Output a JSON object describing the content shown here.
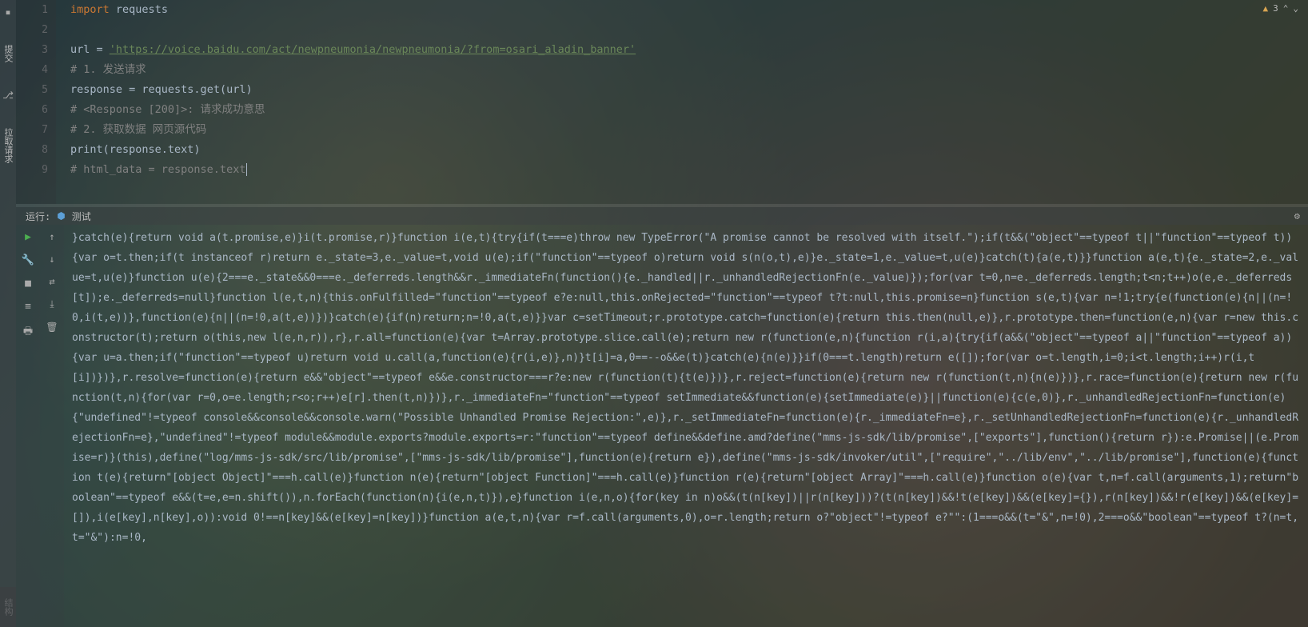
{
  "left_rail": {
    "commit_tab": "提交",
    "pull_tab": "拉取请求"
  },
  "editor": {
    "warning_count": "3",
    "lines": [
      {
        "num": "1",
        "tokens": [
          [
            "kw",
            "import"
          ],
          [
            "plain",
            " "
          ],
          [
            "ident",
            "requests"
          ]
        ]
      },
      {
        "num": "2",
        "tokens": []
      },
      {
        "num": "3",
        "tokens": [
          [
            "ident",
            "url "
          ],
          [
            "plain",
            "= "
          ],
          [
            "str",
            "'https://voice.baidu.com/act/newpneumonia/newpneumonia/?from=osari_aladin_banner'"
          ]
        ]
      },
      {
        "num": "4",
        "tokens": [
          [
            "cmt",
            "# 1. 发送请求"
          ]
        ]
      },
      {
        "num": "5",
        "tokens": [
          [
            "ident",
            "response "
          ],
          [
            "plain",
            "= requests.get(url)"
          ]
        ]
      },
      {
        "num": "6",
        "tokens": [
          [
            "cmt",
            "# <Response [200]>: 请求成功意思"
          ]
        ]
      },
      {
        "num": "7",
        "tokens": [
          [
            "cmt",
            "# 2. 获取数据 网页源代码"
          ]
        ]
      },
      {
        "num": "8",
        "tokens": [
          [
            "fn",
            "print"
          ],
          [
            "plain",
            "(response.text)"
          ]
        ]
      },
      {
        "num": "9",
        "tokens": [
          [
            "cmt",
            "# html_data = response.text"
          ]
        ],
        "cursor": true
      }
    ]
  },
  "console": {
    "run_label": "运行:",
    "run_name": "测试",
    "output": "}catch(e){return void a(t.promise,e)}i(t.promise,r)}function i(e,t){try{if(t===e)throw new TypeError(\"A promise cannot be resolved with itself.\");if(t&&(\"object\"==typeof t||\"function\"==typeof t)){var o=t.then;if(t instanceof r)return e._state=3,e._value=t,void u(e);if(\"function\"==typeof o)return void s(n(o,t),e)}e._state=1,e._value=t,u(e)}catch(t){a(e,t)}}function a(e,t){e._state=2,e._value=t,u(e)}function u(e){2===e._state&&0===e._deferreds.length&&r._immediateFn(function(){e._handled||r._unhandledRejectionFn(e._value)});for(var t=0,n=e._deferreds.length;t<n;t++)o(e,e._deferreds[t]);e._deferreds=null}function l(e,t,n){this.onFulfilled=\"function\"==typeof e?e:null,this.onRejected=\"function\"==typeof t?t:null,this.promise=n}function s(e,t){var n=!1;try{e(function(e){n||(n=!0,i(t,e))},function(e){n||(n=!0,a(t,e))})}catch(e){if(n)return;n=!0,a(t,e)}}var c=setTimeout;r.prototype.catch=function(e){return this.then(null,e)},r.prototype.then=function(e,n){var r=new this.constructor(t);return o(this,new l(e,n,r)),r},r.all=function(e){var t=Array.prototype.slice.call(e);return new r(function(e,n){function r(i,a){try{if(a&&(\"object\"==typeof a||\"function\"==typeof a)){var u=a.then;if(\"function\"==typeof u)return void u.call(a,function(e){r(i,e)},n)}t[i]=a,0==--o&&e(t)}catch(e){n(e)}}if(0===t.length)return e([]);for(var o=t.length,i=0;i<t.length;i++)r(i,t[i])})},r.resolve=function(e){return e&&\"object\"==typeof e&&e.constructor===r?e:new r(function(t){t(e)})},r.reject=function(e){return new r(function(t,n){n(e)})},r.race=function(e){return new r(function(t,n){for(var r=0,o=e.length;r<o;r++)e[r].then(t,n)})},r._immediateFn=\"function\"==typeof setImmediate&&function(e){setImmediate(e)}||function(e){c(e,0)},r._unhandledRejectionFn=function(e){\"undefined\"!=typeof console&&console&&console.warn(\"Possible Unhandled Promise Rejection:\",e)},r._setImmediateFn=function(e){r._immediateFn=e},r._setUnhandledRejectionFn=function(e){r._unhandledRejectionFn=e},\"undefined\"!=typeof module&&module.exports?module.exports=r:\"function\"==typeof define&&define.amd?define(\"mms-js-sdk/lib/promise\",[\"exports\"],function(){return r}):e.Promise||(e.Promise=r)}(this),define(\"log/mms-js-sdk/src/lib/promise\",[\"mms-js-sdk/lib/promise\"],function(e){return e}),define(\"mms-js-sdk/invoker/util\",[\"require\",\"../lib/env\",\"../lib/promise\"],function(e){function t(e){return\"[object Object]\"===h.call(e)}function n(e){return\"[object Function]\"===h.call(e)}function r(e){return\"[object Array]\"===h.call(e)}function o(e){var t,n=f.call(arguments,1);return\"boolean\"==typeof e&&(t=e,e=n.shift()),n.forEach(function(n){i(e,n,t)}),e}function i(e,n,o){for(key in n)o&&(t(n[key])||r(n[key]))?(t(n[key])&&!t(e[key])&&(e[key]={}),r(n[key])&&!r(e[key])&&(e[key]=[]),i(e[key],n[key],o)):void 0!==n[key]&&(e[key]=n[key])}function a(e,t,n){var r=f.call(arguments,0),o=r.length;return o?\"object\"!=typeof e?\"\":(1===o&&(t=\"&\",n=!0),2===o&&\"boolean\"==typeof t?(n=t,t=\"&\"):n=!0,"
  },
  "bottom_rail": {
    "structure_tab": "结构"
  }
}
